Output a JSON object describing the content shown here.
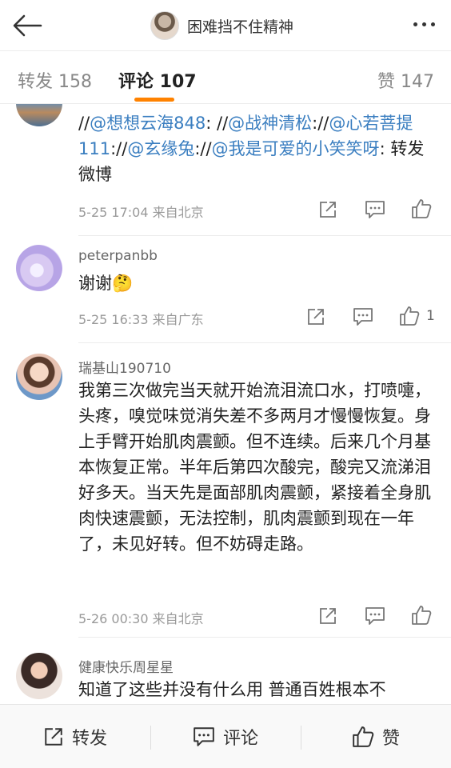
{
  "header": {
    "back_icon": "arrow-left-icon",
    "title": "困难挡不住精神",
    "more_icon": "more-dots-icon"
  },
  "tabs": [
    {
      "label": "转发 158",
      "active": false
    },
    {
      "label": "评论 107",
      "active": true
    },
    {
      "label": "赞 147",
      "active": false
    }
  ],
  "comments": [
    {
      "parts": [
        {
          "t": "//"
        },
        {
          "t": "@想想云海848",
          "at": true
        },
        {
          "t": ": //"
        },
        {
          "t": "@战神清松",
          "at": true
        },
        {
          "t": "://"
        },
        {
          "t": "@心若菩提111",
          "at": true
        },
        {
          "t": "://"
        },
        {
          "t": "@玄缘兔",
          "at": true
        },
        {
          "t": "://"
        },
        {
          "t": "@我是可爱的小笑笑呀",
          "at": true
        },
        {
          "t": ": 转发微博"
        }
      ],
      "time": "5-25 17:04 来自北京",
      "like_count": ""
    },
    {
      "name": "peterpanbb",
      "text": "谢谢",
      "emoji": "🤔",
      "time": "5-25 16:33 来自广东",
      "like_count": "1"
    },
    {
      "name": "瑞基山190710",
      "text": "我第三次做完当天就开始流泪流口水，打喷嚏，头疼，嗅觉味觉消失差不多两月才慢慢恢复。身上手臂开始肌肉震颤。但不连续。后来几个月基本恢复正常。半年后第四次酸完，酸完又流涕泪好多天。当天先是面部肌肉震颤，紧接着全身肌肉快速震颤，无法控制，肌肉震颤到现在一年了，未见好转。但不妨碍走路。",
      "time": "5-26 00:30 来自北京",
      "like_count": ""
    },
    {
      "name": "健康快乐周星星",
      "text": "知道了这些并没有什么用 普通百姓根本不"
    }
  ],
  "bottom": {
    "repost": "转发",
    "comment": "评论",
    "like": "赞"
  }
}
